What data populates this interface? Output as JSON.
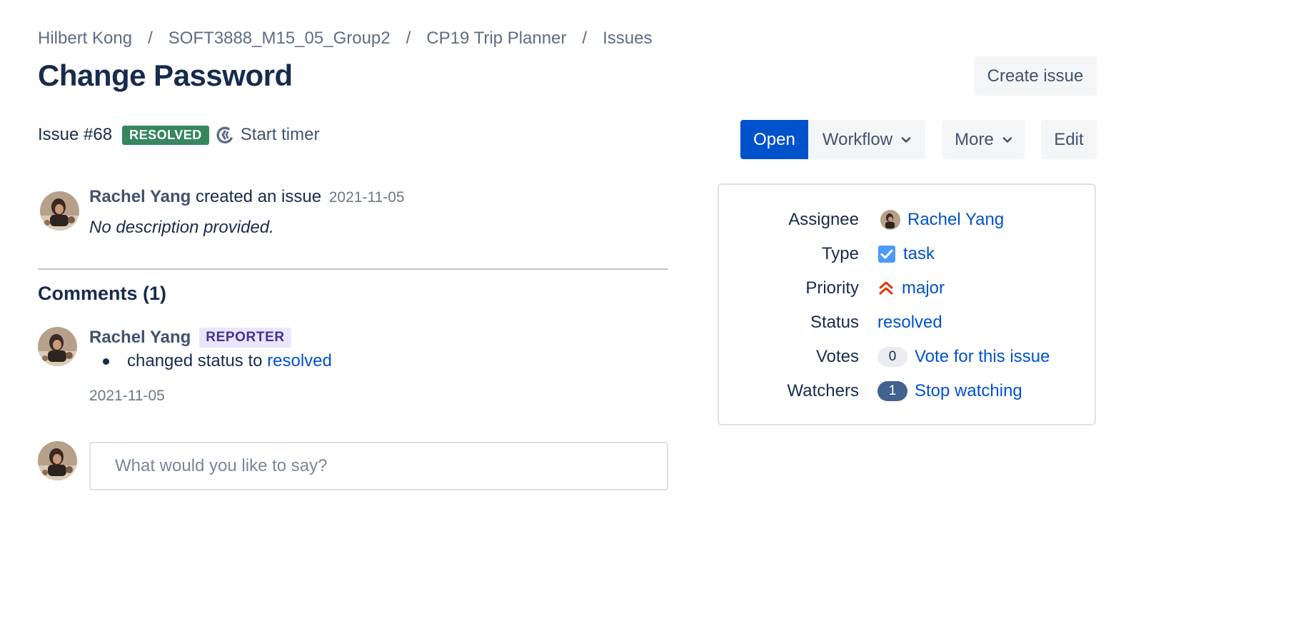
{
  "breadcrumb": {
    "items": [
      "Hilbert Kong",
      "SOFT3888_M15_05_Group2",
      "CP19 Trip Planner",
      "Issues"
    ],
    "separator": "/"
  },
  "title": "Change Password",
  "toolbar": {
    "create_label": "Create issue",
    "open_label": "Open",
    "workflow_label": "Workflow",
    "more_label": "More",
    "edit_label": "Edit"
  },
  "issue": {
    "number": "Issue #68",
    "status_lozenge": "RESOLVED",
    "timer_label": "Start timer"
  },
  "activity": {
    "author": "Rachel Yang",
    "action": "created an issue",
    "date": "2021-11-05",
    "description": "No description provided."
  },
  "comments": {
    "heading": "Comments (1)",
    "items": [
      {
        "author": "Rachel Yang",
        "role": "REPORTER",
        "text": "changed status to",
        "link": "resolved",
        "date": "2021-11-05"
      }
    ],
    "input_placeholder": "What would you like to say?"
  },
  "details": {
    "assignee_label": "Assignee",
    "assignee_value": "Rachel Yang",
    "type_label": "Type",
    "type_value": "task",
    "type_icon": "checkbox-icon",
    "priority_label": "Priority",
    "priority_value": "major",
    "priority_icon": "double-chevron-up-icon",
    "status_label": "Status",
    "status_value": "resolved",
    "votes_label": "Votes",
    "votes_count": "0",
    "votes_action": "Vote for this issue",
    "watchers_label": "Watchers",
    "watchers_count": "1",
    "watchers_action": "Stop watching"
  },
  "colors": {
    "primary": "#0052cc",
    "resolved_green": "#36865f",
    "reporter_purple": "#403294",
    "priority_red": "#de350b"
  }
}
